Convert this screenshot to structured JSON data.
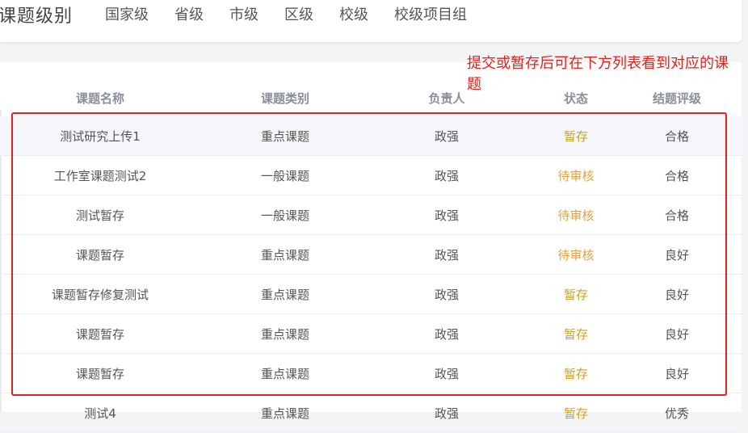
{
  "header": {
    "title": "课题级别",
    "levels": [
      "国家级",
      "省级",
      "市级",
      "区级",
      "校级",
      "校级项目组"
    ]
  },
  "annotation": "提交或暂存后可在下方列表看到对应的课题",
  "table": {
    "columns": [
      "课题名称",
      "课题类别",
      "负责人",
      "状态",
      "结题评级"
    ],
    "rows": [
      {
        "name": "测试研究上传1",
        "category": "重点课题",
        "owner": "政强",
        "status": "暂存",
        "rating": "合格"
      },
      {
        "name": "工作室课题测试2",
        "category": "一般课题",
        "owner": "政强",
        "status": "待审核",
        "rating": "合格"
      },
      {
        "name": "测试暂存",
        "category": "一般课题",
        "owner": "政强",
        "status": "待审核",
        "rating": "合格"
      },
      {
        "name": "课题暂存",
        "category": "重点课题",
        "owner": "政强",
        "status": "待审核",
        "rating": "良好"
      },
      {
        "name": "课题暂存修复测试",
        "category": "重点课题",
        "owner": "政强",
        "status": "暂存",
        "rating": "良好"
      },
      {
        "name": "课题暂存",
        "category": "重点课题",
        "owner": "政强",
        "status": "暂存",
        "rating": "良好"
      },
      {
        "name": "课题暂存",
        "category": "重点课题",
        "owner": "政强",
        "status": "暂存",
        "rating": "良好"
      },
      {
        "name": "测试4",
        "category": "重点课题",
        "owner": "政强",
        "status": "暂存",
        "rating": "优秀"
      }
    ]
  },
  "colors": {
    "annotation_red": "#e0231b",
    "status_save": "#c9a227",
    "status_review": "#e6a23c"
  }
}
